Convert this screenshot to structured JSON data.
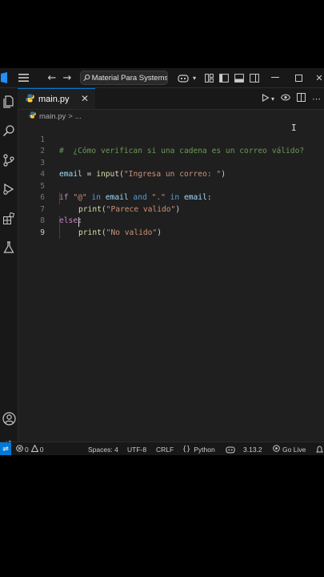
{
  "titlebar": {
    "search_text": "Material Para SystemsBN"
  },
  "tab": {
    "label": "main.py",
    "close": "✕"
  },
  "breadcrumb": {
    "file": "main.py",
    "sep": ">",
    "more": "..."
  },
  "editor": {
    "line_numbers": [
      "1",
      "2",
      "3",
      "4",
      "5",
      "6",
      "7",
      "8",
      "9"
    ],
    "comment": "#  ¿Cómo verifican si una cadena es un correo válido?",
    "l3_var": "email",
    "l3_eq": " = ",
    "l3_fn": "input",
    "l3_open": "(",
    "l3_str": "\"Ingresa un correo: \"",
    "l3_close": ")",
    "l5_if": "if ",
    "l5_s1": "\"@\"",
    "l5_in1": " in ",
    "l5_v1": "email",
    "l5_and": " and ",
    "l5_s2": "\".\"",
    "l5_in2": " in ",
    "l5_v2": "email",
    "l5_colon": ":",
    "l6_fn": "print",
    "l6_open": "(",
    "l6_str": "\"Parece valido\"",
    "l6_close": ")",
    "l7_else": "else",
    "l7_colon": ":",
    "l8_fn": "print",
    "l8_open": "(",
    "l8_str": "\"No valido\"",
    "l8_close": ")"
  },
  "statusbar": {
    "errors": "0",
    "warnings": "0",
    "spaces": "Spaces: 4",
    "encoding": "UTF-8",
    "eol": "CRLF",
    "language": "Python",
    "version": "3.13.2",
    "golive": "Go Live"
  },
  "colors": {
    "accent": "#0078d4",
    "editor_bg": "#1f1f1f",
    "chrome_bg": "#181818"
  }
}
